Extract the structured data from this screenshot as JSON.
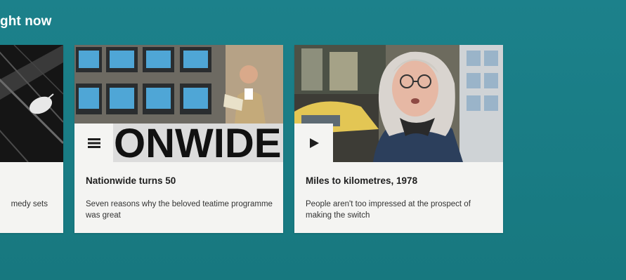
{
  "section": {
    "heading": "ght now"
  },
  "cards": [
    {
      "title": "",
      "summary": "medy sets",
      "icon": "none"
    },
    {
      "title": "Nationwide turns 50",
      "summary": "Seven reasons why the beloved teatime programme was great",
      "icon": "article-menu-icon",
      "image_text": "ONWIDE"
    },
    {
      "title": "Miles to kilometres, 1978",
      "summary": "People aren't too impressed at the prospect of making the switch",
      "icon": "play-icon"
    }
  ],
  "colors": {
    "background": "#1b7f89",
    "card": "#f4f4f2",
    "title": "#1e1e1e",
    "summary": "#333333"
  }
}
